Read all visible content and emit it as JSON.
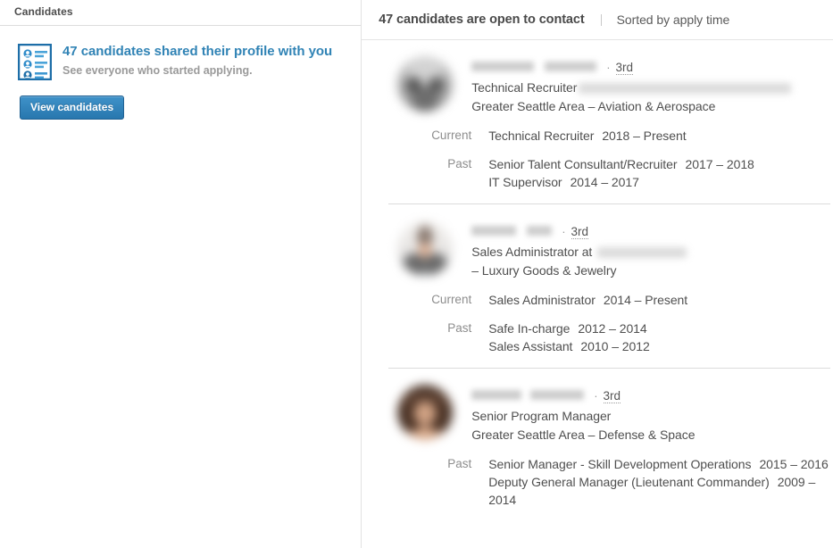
{
  "left": {
    "header_title": "Candidates",
    "promo": {
      "icon": "candidate-list-icon",
      "title": "47 candidates shared their profile with you",
      "subtitle": "See everyone who started applying.",
      "button_label": "View candidates",
      "button_color": "#2877ae",
      "title_color": "#3083b5"
    }
  },
  "right": {
    "header": {
      "count_text": "47 candidates are open to contact",
      "sort_text": "Sorted by apply time"
    },
    "candidates": [
      {
        "name_redacted": true,
        "degree": "3rd",
        "separator": "·",
        "headline": "Technical Recruiter",
        "headline_company_redacted": true,
        "location": "Greater Seattle Area  –  Aviation & Aerospace",
        "avatar": "avatar-blurred-person-1",
        "current_label": "Current",
        "current": [
          {
            "title": "Technical Recruiter",
            "years": "2018 – Present"
          }
        ],
        "past_label": "Past",
        "past": [
          {
            "title": "Senior Talent Consultant/Recruiter",
            "years": "2017 – 2018"
          },
          {
            "title": "IT Supervisor",
            "years": "2014 – 2017"
          }
        ]
      },
      {
        "name_redacted": true,
        "degree": "3rd",
        "separator": "·",
        "headline": "Sales Administrator at",
        "headline_company_redacted": true,
        "location": "–  Luxury Goods & Jewelry",
        "avatar": "avatar-blurred-person-2",
        "current_label": "Current",
        "current": [
          {
            "title": "Sales Administrator",
            "years": "2014 – Present"
          }
        ],
        "past_label": "Past",
        "past": [
          {
            "title": "Safe In-charge",
            "years": "2012 – 2014"
          },
          {
            "title": "Sales Assistant",
            "years": "2010 – 2012"
          }
        ]
      },
      {
        "name_redacted": true,
        "degree": "3rd",
        "separator": "·",
        "headline": "Senior Program Manager",
        "headline_company_redacted": false,
        "location": "Greater Seattle Area  –  Defense & Space",
        "avatar": "avatar-blurred-person-3",
        "past_label": "Past",
        "past": [
          {
            "title": "Senior Manager - Skill Development Operations",
            "years": "2015 – 2016"
          },
          {
            "title": "Deputy General Manager (Lieutenant Commander)",
            "years": "2009 – 2014"
          }
        ]
      }
    ]
  }
}
